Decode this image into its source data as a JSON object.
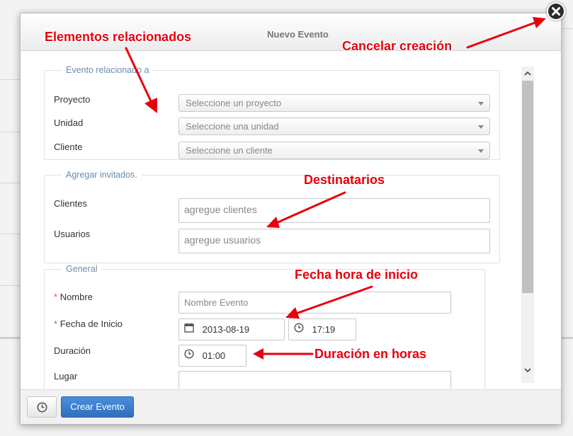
{
  "modal": {
    "title": "Nuevo Evento"
  },
  "sections": {
    "related": {
      "legend": "Evento relacionado a",
      "project_label": "Proyecto",
      "project_placeholder": "Seleccione un proyecto",
      "unit_label": "Unidad",
      "unit_placeholder": "Seleccione una unidad",
      "client_label": "Cliente",
      "client_placeholder": "Seleccione un cliente"
    },
    "guests": {
      "legend": "Agregar invitados.",
      "clients_label": "Clientes",
      "clients_placeholder": "agregue clientes",
      "users_label": "Usuarios",
      "users_placeholder": "agregue usuarios"
    },
    "general": {
      "legend": "General",
      "required_mark": "*",
      "name_label": "Nombre",
      "name_placeholder": "Nombre Evento",
      "start_label": "Fecha de Inicio",
      "start_date": "2013-08-19",
      "start_time": "17:19",
      "duration_label": "Duración",
      "duration_value": "01:00",
      "place_label": "Lugar"
    }
  },
  "footer": {
    "create_label": "Crear Evento"
  },
  "annotations": {
    "related": "Elementos relacionados",
    "cancel": "Cancelar creación",
    "recipients": "Destinatarios",
    "start": "Fecha hora de inicio",
    "duration": "Duración en horas"
  },
  "icons": {
    "close": "close-icon",
    "calendar": "calendar-icon",
    "clock": "clock-icon",
    "caret": "chevron-down-icon"
  },
  "colors": {
    "annotation": "#e8000c",
    "primary_button": "#2f6fbd",
    "legend": "#6a8caf"
  }
}
